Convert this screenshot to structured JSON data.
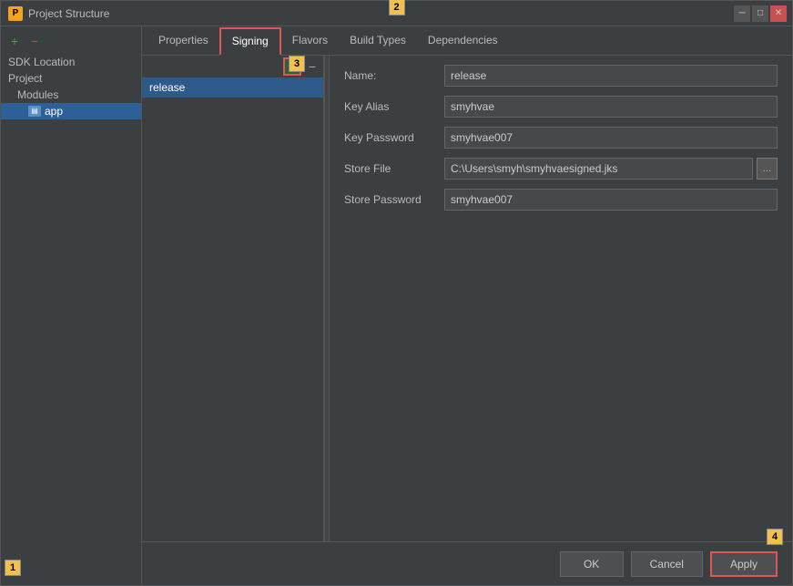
{
  "window": {
    "title": "Project Structure",
    "close_btn": "✕",
    "min_btn": "─",
    "max_btn": "□"
  },
  "sidebar": {
    "add_label": "+",
    "minus_label": "−",
    "items": [
      {
        "label": "SDK Location",
        "indent": 0
      },
      {
        "label": "Project",
        "indent": 0
      },
      {
        "label": "Modules",
        "indent": 1
      },
      {
        "label": "app",
        "indent": 2,
        "selected": true,
        "has_icon": true
      }
    ]
  },
  "tabs": [
    {
      "label": "Properties",
      "active": false
    },
    {
      "label": "Signing",
      "active": true
    },
    {
      "label": "Flavors",
      "active": false
    },
    {
      "label": "Build Types",
      "active": false
    },
    {
      "label": "Dependencies",
      "active": false
    }
  ],
  "config_list": {
    "add_label": "+",
    "remove_label": "−",
    "items": [
      {
        "label": "release",
        "selected": true
      }
    ]
  },
  "form": {
    "fields": [
      {
        "label": "Name:",
        "value": "release",
        "type": "text",
        "has_browse": false
      },
      {
        "label": "Key Alias",
        "value": "smyhvae",
        "type": "text",
        "has_browse": false
      },
      {
        "label": "Key Password",
        "value": "smyhvae007",
        "type": "password",
        "has_browse": false
      },
      {
        "label": "Store File",
        "value": "C:\\Users\\smyh\\smyhvaesigned.jks",
        "type": "text",
        "has_browse": true
      },
      {
        "label": "Store Password",
        "value": "smyhvae007",
        "type": "password",
        "has_browse": false
      }
    ],
    "browse_label": "..."
  },
  "footer": {
    "ok_label": "OK",
    "cancel_label": "Cancel",
    "apply_label": "Apply"
  },
  "badges": {
    "b1": "1",
    "b2": "2",
    "b3": "3",
    "b4": "4"
  }
}
